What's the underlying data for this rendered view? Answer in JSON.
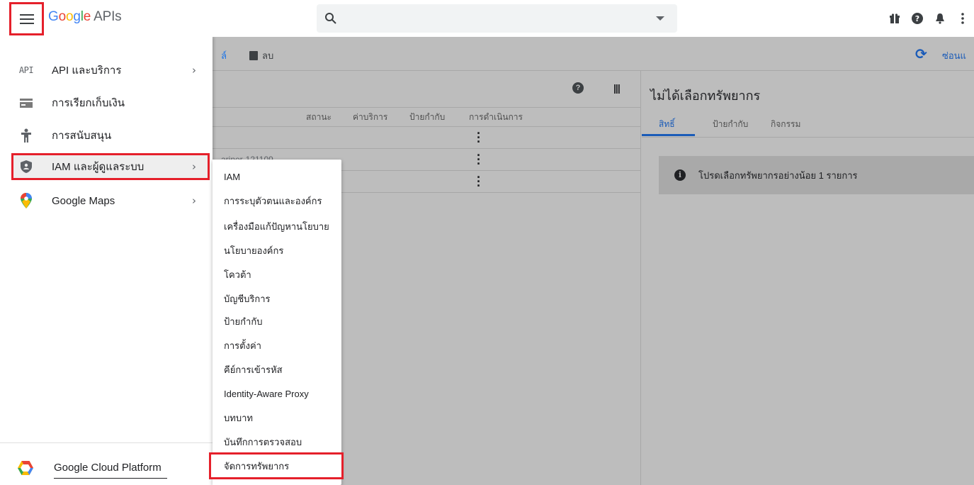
{
  "header": {
    "logo_google": "Google",
    "logo_apis": "APIs",
    "search_placeholder": "",
    "icons": [
      "gift-icon",
      "help-icon",
      "bell-icon",
      "more-vert-icon"
    ]
  },
  "toolbar": {
    "partial_label": "ล์",
    "delete_label": "ลบ",
    "hide_label": "ซ่อนแ"
  },
  "table": {
    "columns": [
      "สถานะ",
      "ค่าบริการ",
      "ป้ายกำกับ",
      "การดำเนินการ"
    ],
    "rows": [
      {
        "name": ""
      },
      {
        "name": "ariner-121109"
      },
      {
        "name": ""
      }
    ]
  },
  "right_panel": {
    "title": "ไม่ได้เลือกทรัพยากร",
    "tabs": [
      "สิทธิ์",
      "ป้ายกำกับ",
      "กิจกรรม"
    ],
    "info_message": "โปรดเลือกทรัพยากรอย่างน้อย 1 รายการ"
  },
  "drawer": {
    "items": [
      {
        "label": "API และบริการ",
        "icon": "api-icon",
        "has_submenu": true
      },
      {
        "label": "การเรียกเก็บเงิน",
        "icon": "billing-icon",
        "has_submenu": false
      },
      {
        "label": "การสนับสนุน",
        "icon": "support-icon",
        "has_submenu": false
      },
      {
        "label": "IAM และผู้ดูแลระบบ",
        "icon": "shield-icon",
        "has_submenu": true
      },
      {
        "label": "Google Maps",
        "icon": "maps-pin-icon",
        "has_submenu": true
      }
    ],
    "api_icon_text": "API",
    "footer_label": "Google Cloud Platform"
  },
  "submenu": {
    "items": [
      "IAM",
      "การระบุตัวตนและองค์กร",
      "เครื่องมือแก้ปัญหานโยบาย",
      "นโยบายองค์กร",
      "โควต้า",
      "บัญชีบริการ",
      "ป้ายกำกับ",
      "การตั้งค่า",
      "คีย์การเข้ารหัส",
      "Identity-Aware Proxy",
      "บทบาท",
      "บันทึกการตรวจสอบ",
      "จัดการทรัพยากร"
    ]
  },
  "colors": {
    "highlight": "#e5202b",
    "accent_blue": "#1a5bb8",
    "overlay_gray": "#bdbdbd"
  }
}
